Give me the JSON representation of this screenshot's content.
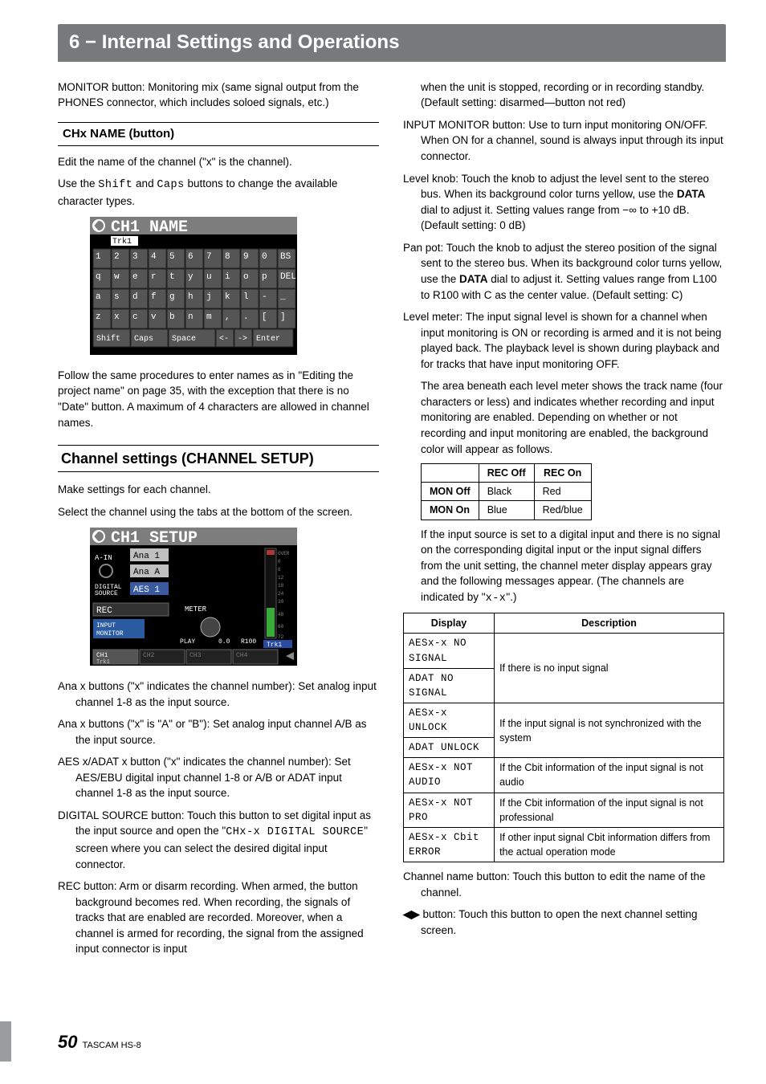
{
  "header": "6 − Internal Settings and Operations",
  "left": {
    "p1": "MONITOR button: Monitoring mix (same signal output from the PHONES connector, which includes soloed signals, etc.)",
    "chx_head": " CHx NAME (button)",
    "p2": "Edit the name of the channel (\"x\" is the channel).",
    "p3a": "Use the ",
    "p3_shift": "Shift",
    "p3b": " and ",
    "p3_caps": "Caps",
    "p3c": " buttons to change the available character types.",
    "name_title": "CH1 NAME",
    "name_track": "Trk1",
    "name_rows": [
      [
        "1",
        "2",
        "3",
        "4",
        "5",
        "6",
        "7",
        "8",
        "9",
        "0",
        "BS"
      ],
      [
        "q",
        "w",
        "e",
        "r",
        "t",
        "y",
        "u",
        "i",
        "o",
        "p",
        "DEL"
      ],
      [
        "a",
        "s",
        "d",
        "f",
        "g",
        "h",
        "j",
        "k",
        "l",
        "-",
        "_"
      ],
      [
        "z",
        "x",
        "c",
        "v",
        "b",
        "n",
        "m",
        ",",
        ".",
        "[",
        "]"
      ]
    ],
    "name_bottom": [
      "Shift",
      "Caps",
      "Space",
      "<-",
      "->",
      "Enter"
    ],
    "p4": "Follow the same procedures to enter names as in \"Editing the project name\" on page 35, with the exception that there is no \"Date\" button. A maximum of 4 characters are allowed in channel names.",
    "chset_head": "Channel settings (CHANNEL SETUP)",
    "p5": "Make settings for each channel.",
    "p6": "Select the channel using the tabs at the bottom of the screen.",
    "setup_title": "CH1 SETUP",
    "setup_labels": {
      "ain": "A-IN",
      "ana1": "Ana 1",
      "anaA": "Ana A",
      "digsrc": "DIGITAL SOURCE",
      "aes1": "AES 1",
      "rec": "REC",
      "inpmon": "INPUT MONITOR",
      "meter": "METER",
      "play": "PLAY",
      "pan_c": "0.0",
      "pan_r": "R100",
      "trk1": "Trk1",
      "tabs": [
        "CH1",
        "CH2",
        "CH3",
        "CH4"
      ],
      "tab_sub": [
        "Trk1",
        "",
        "",
        "",
        ""
      ]
    },
    "p7": "Ana x buttons (\"x\" indicates the channel number): Set analog input channel 1-8 as the input source.",
    "p8": "Ana x buttons (\"x\" is \"A\" or \"B\"): Set analog input channel A/B as the input source.",
    "p9": "AES x/ADAT x button (\"x\" indicates the channel number): Set AES/EBU digital input channel 1-8 or A/B or ADAT input channel 1-8 as the input source.",
    "p10a": "DIGITAL SOURCE button: Touch this button to set digital input as the input source and open the \"",
    "p10_code": "CHx-x DIGITAL SOURCE",
    "p10b": "\" screen where you can select the desired digital input connector.",
    "p11": "REC button: Arm or disarm recording. When armed, the button background becomes red. When recording, the signals of tracks that are enabled are recorded. Moreover, when a channel is armed for recording, the signal from the assigned input connector is input"
  },
  "right": {
    "p1": "when the unit is stopped, recording or in recording standby.  (Default setting: disarmed—button not red)",
    "p2": "INPUT MONITOR button: Use to turn input monitoring ON/OFF. When ON for a channel, sound is always input through its input connector.",
    "p3a": "Level knob: Touch the knob to adjust the level sent to the stereo bus. When its background color turns yellow, use the ",
    "p3_bold": "DATA",
    "p3b": " dial to adjust it. Setting values range from −∞ to +10 dB. (Default setting: 0 dB)",
    "p4a": "Pan pot: Touch the knob to adjust the stereo position of the signal sent to the stereo bus. When its background color turns yellow, use the ",
    "p4_bold": "DATA",
    "p4b": " dial to adjust it. Setting values range from L100 to R100 with C as the center value. (Default setting: C)",
    "p5": "Level meter: The input signal level is shown for a channel when input monitoring is ON or recording is armed and it is not being played back. The playback level is shown during playback and for tracks that have input monitoring OFF.",
    "p6": "The area beneath each level meter shows the track name (four characters or less) and indicates whether recording and input monitoring are enabled. Depending on whether or not recording and input monitoring are enabled, the background color will appear as follows.",
    "monrec": {
      "h1": "REC Off",
      "h2": "REC On",
      "r1_label": "MON Off",
      "r1_a": "Black",
      "r1_b": "Red",
      "r2_label": "MON On",
      "r2_a": "Blue",
      "r2_b": "Red/blue"
    },
    "p7a": "If the input source is set to a digital input and there is no signal on the corresponding digital input or the input signal differs from the unit setting, the channel meter display appears gray and the following messages appear. (The channels are indicated by \"",
    "p7_code": "x-x",
    "p7b": "\".)",
    "display_table": {
      "h1": "Display",
      "h2": "Description",
      "r1a": "AESx-x NO SIGNAL",
      "r1b": "ADAT NO SIGNAL",
      "r1_desc": "If there is no input signal",
      "r2a": "AESx-x UNLOCK",
      "r2b": "ADAT UNLOCK",
      "r2_desc": "If the input signal is not synchronized with the system",
      "r3a": "AESx-x NOT AUDIO",
      "r3_desc": "If the Cbit information of the input signal is not audio",
      "r4a": "AESx-x NOT PRO",
      "r4_desc": "If the Cbit information of the input signal is not professional",
      "r5a": "AESx-x Cbit ERROR",
      "r5_desc": "If other input signal Cbit information differs from the actual operation mode"
    },
    "p8": "Channel name button: Touch this button to edit the name of the channel.",
    "p9": " button: Touch this button to open the next channel setting screen."
  },
  "footer": {
    "page": "50",
    "model": "TASCAM  HS-8"
  }
}
